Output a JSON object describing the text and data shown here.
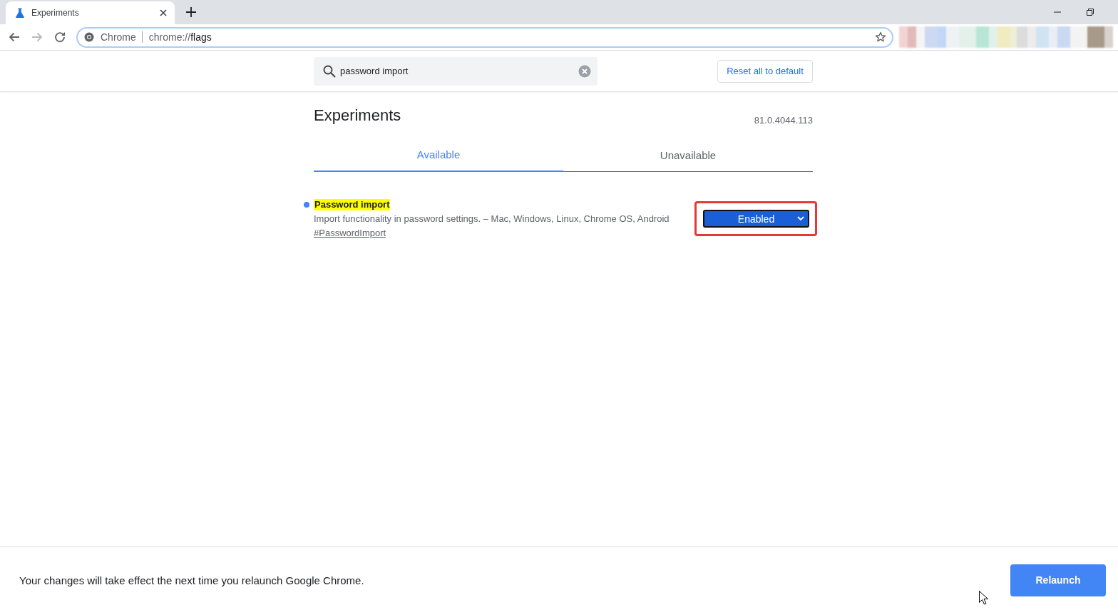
{
  "browser": {
    "tabs": [
      {
        "title": "Experiments",
        "selected": true
      }
    ],
    "address_bar": {
      "site_label": "Chrome",
      "url_scheme": "chrome://",
      "url_path": "flags"
    }
  },
  "flags_page": {
    "search": {
      "value": "password import"
    },
    "reset_button": "Reset all to default",
    "title": "Experiments",
    "version": "81.0.4044.113",
    "tabs": [
      {
        "label": "Available",
        "selected": true
      },
      {
        "label": "Unavailable",
        "selected": false
      }
    ],
    "flags": [
      {
        "title": "Password import",
        "modified": true,
        "title_highlighted": true,
        "description": "Import functionality in password settings. – Mac, Windows, Linux, Chrome OS, Android",
        "link": "#PasswordImport",
        "value": "Enabled",
        "outlined": true
      }
    ]
  },
  "relaunch_bar": {
    "message": "Your changes will take effect the next time you relaunch Google Chrome.",
    "button": "Relaunch"
  }
}
